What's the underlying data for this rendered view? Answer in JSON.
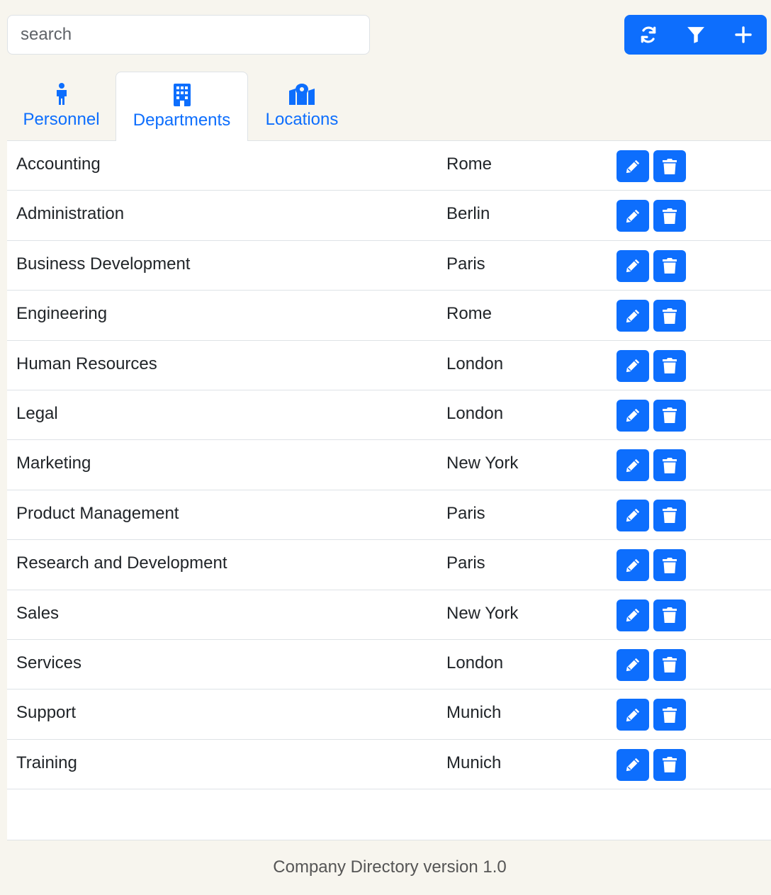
{
  "search": {
    "placeholder": "search"
  },
  "toolbar": {
    "buttons": [
      {
        "icon": "refresh-icon"
      },
      {
        "icon": "filter-icon"
      },
      {
        "icon": "plus-icon"
      }
    ]
  },
  "tabs": [
    {
      "label": "Personnel",
      "icon": "person-icon",
      "active": false
    },
    {
      "label": "Departments",
      "icon": "building-icon",
      "active": true
    },
    {
      "label": "Locations",
      "icon": "map-location-icon",
      "active": false
    }
  ],
  "departments": [
    {
      "name": "Accounting",
      "location": "Rome"
    },
    {
      "name": "Administration",
      "location": "Berlin"
    },
    {
      "name": "Business Development",
      "location": "Paris"
    },
    {
      "name": "Engineering",
      "location": "Rome"
    },
    {
      "name": "Human Resources",
      "location": "London"
    },
    {
      "name": "Legal",
      "location": "London"
    },
    {
      "name": "Marketing",
      "location": "New York"
    },
    {
      "name": "Product Management",
      "location": "Paris"
    },
    {
      "name": "Research and Development",
      "location": "Paris"
    },
    {
      "name": "Sales",
      "location": "New York"
    },
    {
      "name": "Services",
      "location": "London"
    },
    {
      "name": "Support",
      "location": "Munich"
    },
    {
      "name": "Training",
      "location": "Munich"
    }
  ],
  "row_actions": {
    "edit_icon": "pencil-icon",
    "delete_icon": "trash-icon"
  },
  "footer": {
    "text": "Company Directory version 1.0"
  },
  "colors": {
    "accent": "#0d6efd",
    "background": "#f7f5ee"
  }
}
